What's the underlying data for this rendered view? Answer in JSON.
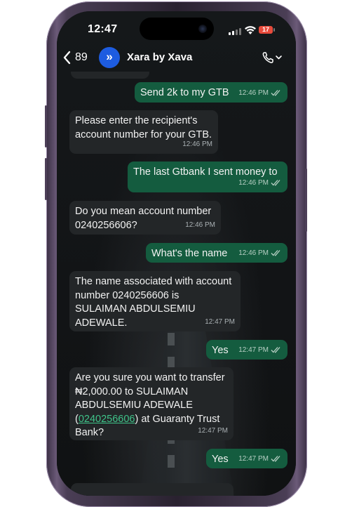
{
  "status_bar": {
    "time": "12:47",
    "battery": "17"
  },
  "header": {
    "back_count": "89",
    "avatar_glyph": "»",
    "chat_name": "Xara by Xava"
  },
  "messages": [
    {
      "direction": "out",
      "text": "Send 2k to my GTB",
      "time": "12:46 PM"
    },
    {
      "direction": "in",
      "text": "Please enter the recipient's\naccount number for your GTB.",
      "time": "12:46 PM"
    },
    {
      "direction": "out",
      "text": "The last Gtbank I sent money to",
      "time": "12:46 PM"
    },
    {
      "direction": "in",
      "text": "Do you mean account number\n0240256606?",
      "time": "12:46 PM"
    },
    {
      "direction": "out",
      "text": "What's the name",
      "time": "12:46 PM"
    },
    {
      "direction": "in",
      "text": "The name associated with account\nnumber 0240256606 is\nSULAIMAN ABDULSEMIU\nADEWALE.",
      "time": "12:47 PM"
    },
    {
      "direction": "out",
      "text": "Yes",
      "time": "12:47 PM"
    },
    {
      "direction": "in",
      "text_before": "Are you sure you want to transfer\n₦2,000.00 to SULAIMAN\nABDULSEMIU ADEWALE\n(",
      "link": "0240256606",
      "text_after": ") at Guaranty Trust\nBank?",
      "time": "12:47 PM"
    },
    {
      "direction": "out",
      "text": "Yes",
      "time": "12:47 PM"
    }
  ],
  "colors": {
    "incoming": "#232628",
    "outgoing": "#145c3f",
    "link": "#3fc389",
    "avatar": "#1d5ce0",
    "battery": "#e84b3c"
  },
  "icons": [
    "back-chevron-icon",
    "xava-logo-icon",
    "phone-call-icon",
    "chevron-down-icon",
    "signal-icon",
    "wifi-icon",
    "battery-icon",
    "double-check-icon"
  ]
}
